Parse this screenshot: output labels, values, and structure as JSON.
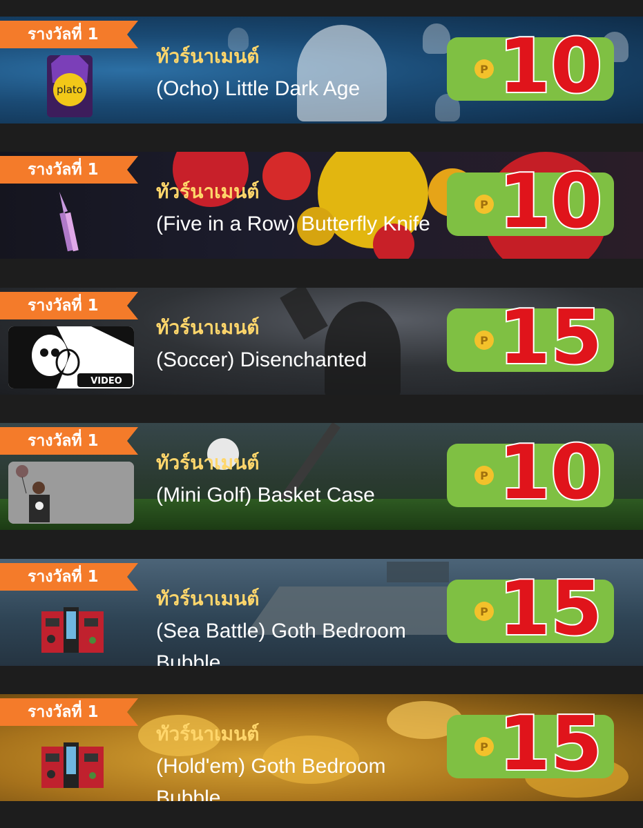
{
  "rewards": [
    {
      "rank_label": "รางวัลที่ 1",
      "tournament_label": "ทัวร์นาเมนต์",
      "game_title": "(Ocho) Little Dark Age",
      "points": "10",
      "thumb": "plato-card",
      "thumb_text": "plato"
    },
    {
      "rank_label": "รางวัลที่ 1",
      "tournament_label": "ทัวร์นาเมนต์",
      "game_title": "(Five in a Row) Butterfly Knife",
      "points": "10",
      "thumb": "butterfly-knife"
    },
    {
      "rank_label": "รางวัลที่ 1",
      "tournament_label": "ทัวร์นาเมนต์",
      "game_title": "(Soccer) Disenchanted",
      "points": "15",
      "thumb": "skull-video",
      "thumb_text": "VIDEO"
    },
    {
      "rank_label": "รางวัลที่ 1",
      "tournament_label": "ทัวร์นาเมนต์",
      "game_title": "(Mini Golf) Basket Case",
      "points": "10",
      "thumb": "skull-shirt-avatar"
    },
    {
      "rank_label": "รางวัลที่ 1",
      "tournament_label": "ทัวร์นาเมนต์",
      "game_title": "(Sea Battle) Goth Bedroom Bubble",
      "points": "15",
      "thumb": "goth-bedroom"
    },
    {
      "rank_label": "รางวัลที่ 1",
      "tournament_label": "ทัวร์นาเมนต์",
      "game_title": "(Hold'em) Goth Bedroom Bubble",
      "points": "15",
      "thumb": "goth-bedroom"
    }
  ],
  "colors": {
    "ribbon": "#f47b2a",
    "badge": "#7fc043",
    "points": "#e0141b",
    "tournament": "#ffd66b"
  }
}
